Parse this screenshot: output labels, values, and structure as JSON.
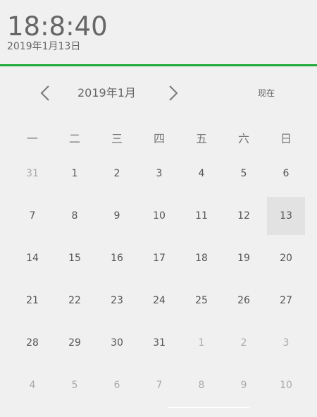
{
  "header": {
    "time": "18:8:40",
    "date": "2019年1月13日",
    "accent_color": "#1faa3a"
  },
  "calendar": {
    "month_label": "2019年1月",
    "prev_icon": "chevron-left-icon",
    "next_icon": "chevron-right-icon",
    "today_label": "现在",
    "weekdays": [
      "一",
      "二",
      "三",
      "四",
      "五",
      "六",
      "日"
    ],
    "selected_day": 13,
    "weeks": [
      [
        {
          "d": "31",
          "m": true
        },
        {
          "d": "1"
        },
        {
          "d": "2"
        },
        {
          "d": "3"
        },
        {
          "d": "4"
        },
        {
          "d": "5"
        },
        {
          "d": "6"
        }
      ],
      [
        {
          "d": "7"
        },
        {
          "d": "8"
        },
        {
          "d": "9"
        },
        {
          "d": "10"
        },
        {
          "d": "11"
        },
        {
          "d": "12"
        },
        {
          "d": "13",
          "s": true
        }
      ],
      [
        {
          "d": "14"
        },
        {
          "d": "15"
        },
        {
          "d": "16"
        },
        {
          "d": "17"
        },
        {
          "d": "18"
        },
        {
          "d": "19"
        },
        {
          "d": "20"
        }
      ],
      [
        {
          "d": "21"
        },
        {
          "d": "22"
        },
        {
          "d": "23"
        },
        {
          "d": "24"
        },
        {
          "d": "25"
        },
        {
          "d": "26"
        },
        {
          "d": "27"
        }
      ],
      [
        {
          "d": "28"
        },
        {
          "d": "29"
        },
        {
          "d": "30"
        },
        {
          "d": "31"
        },
        {
          "d": "1",
          "m": true
        },
        {
          "d": "2",
          "m": true
        },
        {
          "d": "3",
          "m": true
        }
      ],
      [
        {
          "d": "4",
          "m": true
        },
        {
          "d": "5",
          "m": true
        },
        {
          "d": "6",
          "m": true
        },
        {
          "d": "7",
          "m": true
        },
        {
          "d": "8",
          "m": true
        },
        {
          "d": "9",
          "m": true
        },
        {
          "d": "10",
          "m": true
        }
      ]
    ]
  }
}
